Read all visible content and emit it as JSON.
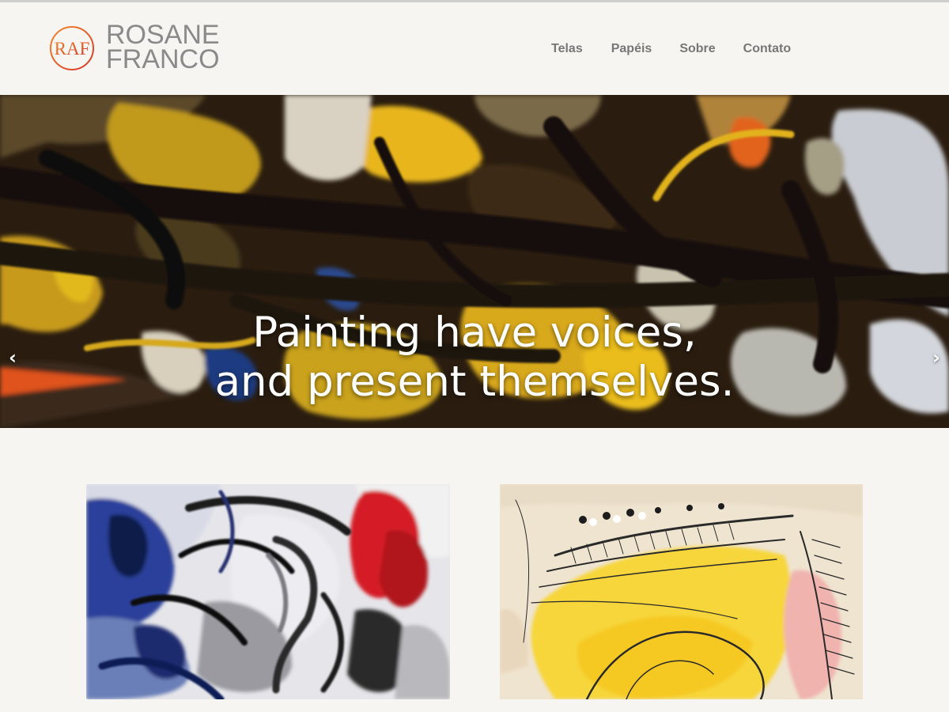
{
  "brand": {
    "monogram": "RAF",
    "name_line1": "ROSANE",
    "name_line2": "FRANCO",
    "accent_color": "#e8643a"
  },
  "nav": {
    "items": [
      "Telas",
      "Papéis",
      "Sobre",
      "Contato"
    ]
  },
  "hero": {
    "title_line1": "Painting have voices,",
    "title_line2": "and present themselves.",
    "prev_icon": "chevron-left-icon",
    "next_icon": "chevron-right-icon"
  },
  "gallery": {
    "items": [
      {
        "image": "abstract-blue-white-red-painting"
      },
      {
        "image": "yellow-pink-ink-drawing"
      }
    ]
  },
  "colors": {
    "background": "#f6f5f2",
    "nav_text": "#777777",
    "logo_text": "#8a8a8a"
  }
}
